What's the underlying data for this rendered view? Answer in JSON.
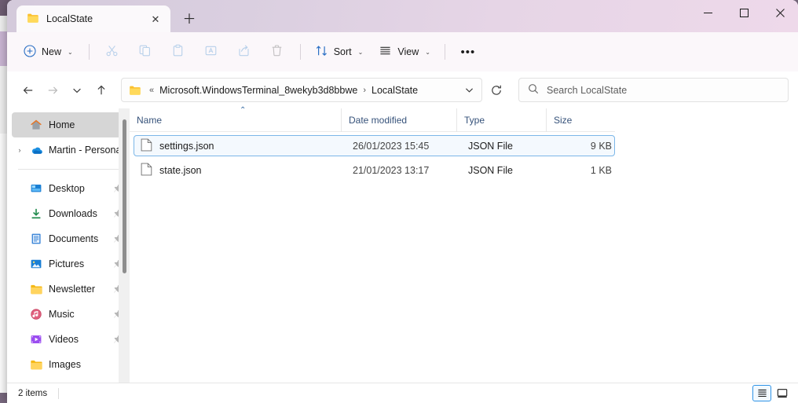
{
  "window": {
    "tab": {
      "title": "LocalState",
      "icon": "folder-icon",
      "close_label": "✕"
    },
    "new_tab_label": "＋",
    "controls": {
      "minimize": "—",
      "maximize": "☐",
      "close": "✕"
    }
  },
  "toolbar": {
    "new_label": "New",
    "new_chevron": "⌄",
    "cut_label": "Cut",
    "copy_label": "Copy",
    "paste_label": "Paste",
    "rename_label": "Rename",
    "share_label": "Share",
    "delete_label": "Delete",
    "sort_label": "Sort",
    "sort_chevron": "⌄",
    "view_label": "View",
    "view_chevron": "⌄",
    "more_label": "•••"
  },
  "address": {
    "back_label": "←",
    "forward_label": "→",
    "recent_label": "⌄",
    "up_label": "↑",
    "overflow": "«",
    "separator": "›",
    "segments": [
      "Microsoft.WindowsTerminal_8wekyb3d8bbwe",
      "LocalState"
    ],
    "dropdown_chevron": "⌄",
    "refresh_label": "⟳"
  },
  "search": {
    "placeholder": "Search LocalState",
    "value": "",
    "icon": "search-icon"
  },
  "sidebar": {
    "items": [
      {
        "label": "Home",
        "icon": "home-icon",
        "selected": true,
        "expandable": false,
        "pinned": false
      },
      {
        "label": "Martin - Personal",
        "icon": "onedrive-icon",
        "selected": false,
        "expandable": true,
        "pinned": false
      },
      {
        "label": "Desktop",
        "icon": "desktop-icon",
        "selected": false,
        "expandable": false,
        "pinned": true
      },
      {
        "label": "Downloads",
        "icon": "downloads-icon",
        "selected": false,
        "expandable": false,
        "pinned": true
      },
      {
        "label": "Documents",
        "icon": "documents-icon",
        "selected": false,
        "expandable": false,
        "pinned": true
      },
      {
        "label": "Pictures",
        "icon": "pictures-icon",
        "selected": false,
        "expandable": false,
        "pinned": true
      },
      {
        "label": "Newsletter",
        "icon": "folder-icon",
        "selected": false,
        "expandable": false,
        "pinned": true
      },
      {
        "label": "Music",
        "icon": "music-icon",
        "selected": false,
        "expandable": false,
        "pinned": true
      },
      {
        "label": "Videos",
        "icon": "videos-icon",
        "selected": false,
        "expandable": false,
        "pinned": true
      },
      {
        "label": "Images",
        "icon": "folder-icon",
        "selected": false,
        "expandable": false,
        "pinned": false
      }
    ],
    "expand_glyph": "›",
    "pin_glyph": "pin-icon"
  },
  "filelist": {
    "columns": [
      "Name",
      "Date modified",
      "Type",
      "Size"
    ],
    "sort_indicator": "⌃",
    "rows": [
      {
        "name": "settings.json",
        "date": "26/01/2023 15:45",
        "type": "JSON File",
        "size": "9 KB",
        "selected": true,
        "icon": "json-file-icon"
      },
      {
        "name": "state.json",
        "date": "21/01/2023 13:17",
        "type": "JSON File",
        "size": "1 KB",
        "selected": false,
        "icon": "json-file-icon"
      }
    ]
  },
  "statusbar": {
    "item_count": "2 items",
    "details_view_label": "Details view",
    "large_icons_view_label": "Large icons view"
  },
  "colors": {
    "titlebar_start": "#d4cadb",
    "titlebar_end": "#eed9ea",
    "accent_blue": "#2e93e6",
    "selection_bg": "#f4f9fe",
    "selection_border": "#7cb7e8",
    "sidebar_selected": "#d6d6d6",
    "header_text": "#36527a"
  }
}
